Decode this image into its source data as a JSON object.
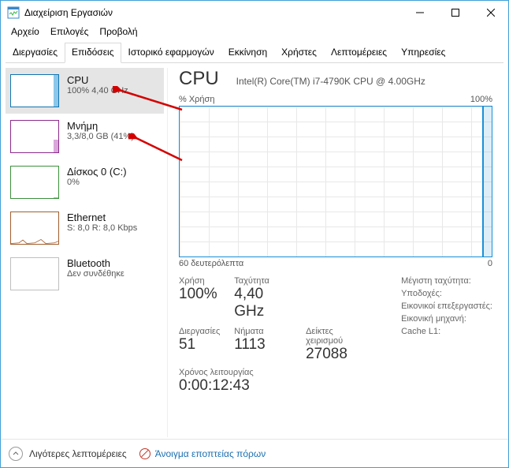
{
  "window": {
    "title": "Διαχείριση Εργασιών"
  },
  "menubar": [
    "Αρχείο",
    "Επιλογές",
    "Προβολή"
  ],
  "tabs": [
    "Διεργασίες",
    "Επιδόσεις",
    "Ιστορικό εφαρμογών",
    "Εκκίνηση",
    "Χρήστες",
    "Λεπτομέρειες",
    "Υπηρεσίες"
  ],
  "active_tab": 1,
  "sidebar": {
    "items": [
      {
        "title": "CPU",
        "sub": "100% 4,40 GHz"
      },
      {
        "title": "Μνήμη",
        "sub": "3,3/8,0 GB (41%)"
      },
      {
        "title": "Δίσκος 0 (C:)",
        "sub": "0%"
      },
      {
        "title": "Ethernet",
        "sub": "S: 8,0 R: 8,0 Kbps"
      },
      {
        "title": "Bluetooth",
        "sub": "Δεν συνδέθηκε"
      }
    ]
  },
  "main": {
    "title": "CPU",
    "cpu_name": "Intel(R) Core(TM) i7-4790K CPU @ 4.00GHz",
    "chart": {
      "y_label": "% Χρήση",
      "y_max": "100%",
      "x_label": "60 δευτερόλεπτα",
      "x_min": "0"
    },
    "stats": {
      "usage_label": "Χρήση",
      "usage": "100%",
      "speed_label": "Ταχύτητα",
      "speed": "4,40 GHz",
      "procs_label": "Διεργασίες",
      "procs": "51",
      "threads_label": "Νήματα",
      "threads": "1113",
      "handles_label": "Δείκτες χειρισμού",
      "handles": "27088",
      "uptime_label": "Χρόνος λειτουργίας",
      "uptime": "0:00:12:43"
    },
    "right": {
      "max_speed": "Μέγιστη ταχύτητα:",
      "sockets": "Υποδοχές:",
      "virt_cpus": "Εικονικοί επεξεργαστές:",
      "vm": "Εικονική μηχανή:",
      "l1": "Cache L1:"
    }
  },
  "footer": {
    "fewer": "Λιγότερες λεπτομέρειες",
    "resmon": "Άνοιγμα εποπτείας πόρων"
  },
  "chart_data": {
    "type": "line",
    "title": "% Χρήση",
    "xlabel": "60 δευτερόλεπτα",
    "ylabel": "%",
    "ylim": [
      0,
      100
    ],
    "x_range_seconds": [
      60,
      0
    ],
    "series": [
      {
        "name": "CPU",
        "x": [
          60,
          3,
          1,
          0
        ],
        "values": [
          0,
          0,
          100,
          100
        ]
      }
    ]
  }
}
